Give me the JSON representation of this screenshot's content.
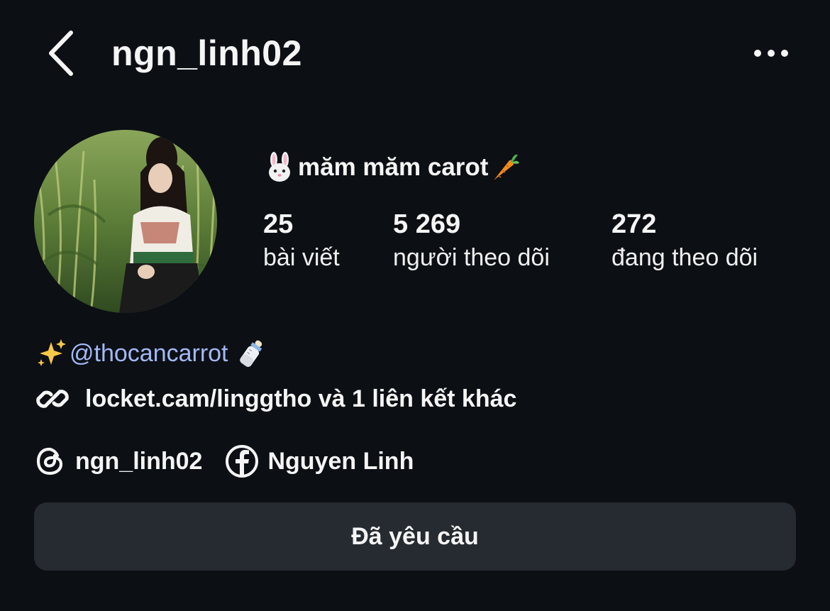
{
  "header": {
    "username": "ngn_linh02"
  },
  "profile": {
    "display_name": "măm măm carot",
    "stats": [
      {
        "value": "25",
        "label": "bài viết"
      },
      {
        "value": "5 269",
        "label": "người theo dõi"
      },
      {
        "value": "272",
        "label": "đang theo dõi"
      }
    ]
  },
  "bio": {
    "mention": "@thocancarrot",
    "link_text": "locket.cam/linggtho và 1 liên kết khác"
  },
  "social": {
    "threads_label": "ngn_linh02",
    "facebook_label": "Nguyen Linh"
  },
  "action": {
    "requested_label": "Đã yêu cầu"
  },
  "colors": {
    "background": "#0c0f14",
    "mention": "#a3b8f5",
    "button": "#262a31"
  }
}
